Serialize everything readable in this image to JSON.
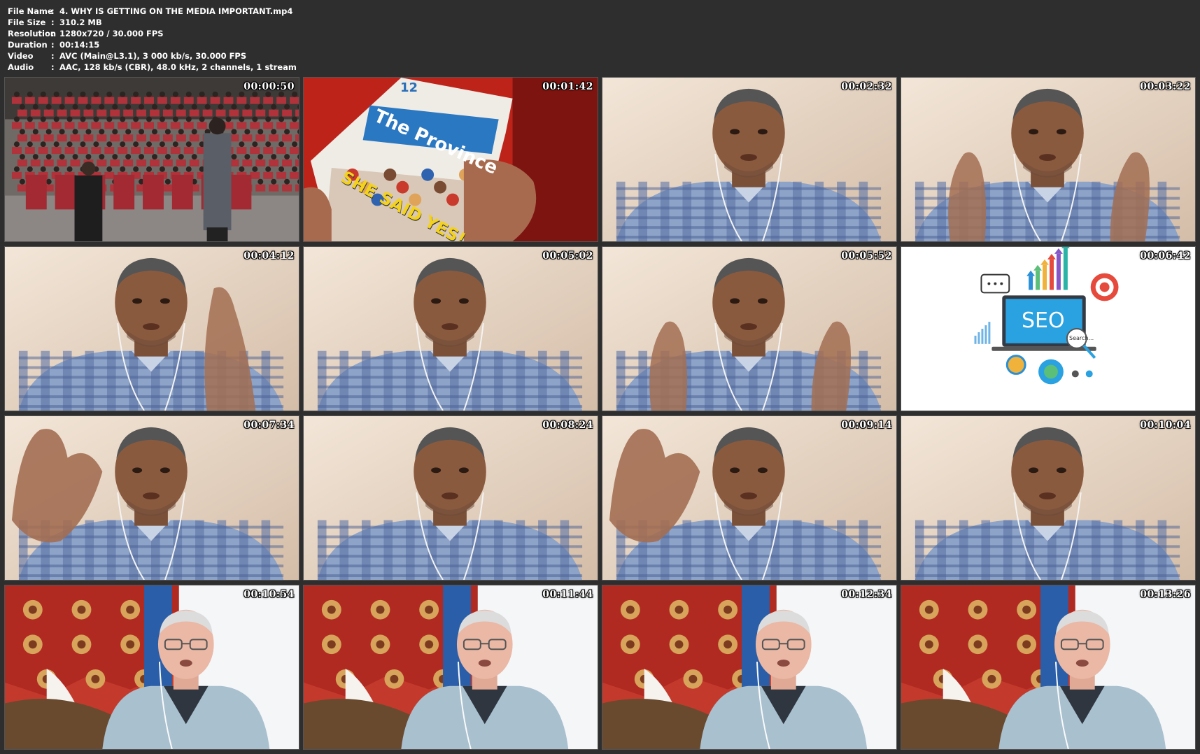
{
  "info": [
    {
      "label": "File Name",
      "value": "4. WHY IS GETTING ON THE MEDIA IMPORTANT.mp4"
    },
    {
      "label": "File Size",
      "value": "310.2 MB"
    },
    {
      "label": "Resolution",
      "value": "1280x720 / 30.000 FPS"
    },
    {
      "label": "Duration",
      "value": "00:14:15"
    },
    {
      "label": "Video",
      "value": "AVC (Main@L3.1), 3 000 kb/s, 30.000 FPS"
    },
    {
      "label": "Audio",
      "value": "AAC, 128 kb/s (CBR), 48.0 kHz, 2 channels, 1 stream"
    }
  ],
  "separator": ":",
  "thumbnails": [
    {
      "time": "00:00:50",
      "scene": "conference-audience"
    },
    {
      "time": "00:01:42",
      "scene": "newspaper"
    },
    {
      "time": "00:02:32",
      "scene": "speaker-man-1"
    },
    {
      "time": "00:03:22",
      "scene": "speaker-man-1"
    },
    {
      "time": "00:04:12",
      "scene": "speaker-man-1"
    },
    {
      "time": "00:05:02",
      "scene": "speaker-man-1"
    },
    {
      "time": "00:05:52",
      "scene": "speaker-man-1"
    },
    {
      "time": "00:06:42",
      "scene": "seo-graphic"
    },
    {
      "time": "00:07:34",
      "scene": "speaker-man-1"
    },
    {
      "time": "00:08:24",
      "scene": "speaker-man-1"
    },
    {
      "time": "00:09:14",
      "scene": "speaker-man-1"
    },
    {
      "time": "00:10:04",
      "scene": "speaker-man-1"
    },
    {
      "time": "00:10:54",
      "scene": "speaker-man-2"
    },
    {
      "time": "00:11:44",
      "scene": "speaker-man-2"
    },
    {
      "time": "00:12:34",
      "scene": "speaker-man-2"
    },
    {
      "time": "00:13:26",
      "scene": "speaker-man-2"
    }
  ],
  "newspaper": {
    "masthead": "The Province",
    "headline": "SHE SAID YES!",
    "issue_number": "12"
  },
  "seo": {
    "label": "SEO",
    "search_text": "Search..."
  }
}
